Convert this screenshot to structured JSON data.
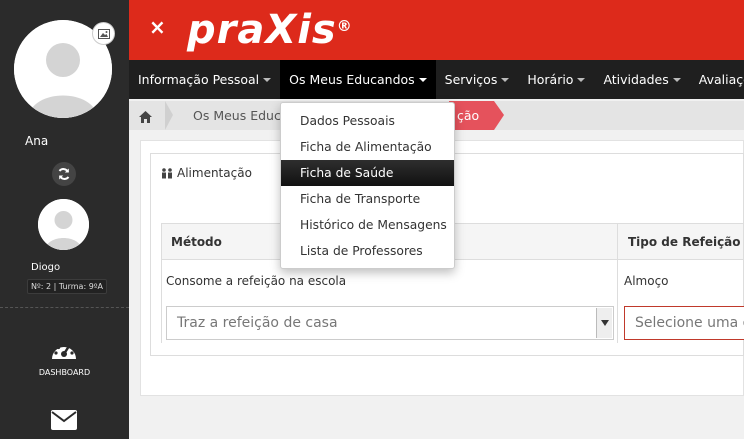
{
  "header": {
    "close_label": "×",
    "logo_text": "praXis",
    "logo_mark": "®",
    "brand_color": "#dd2a1b"
  },
  "sidebar": {
    "user_name": "Ana",
    "child_name": "Diogo",
    "child_info": "Nº: 2 | Turma: 9ºA",
    "dashboard_label": "DASHBOARD",
    "icons": [
      "photo-icon",
      "refresh-icon",
      "dashboard-icon",
      "mail-icon"
    ]
  },
  "nav": {
    "items": [
      {
        "label": "Informação Pessoal"
      },
      {
        "label": "Os Meus Educandos"
      },
      {
        "label": "Serviços"
      },
      {
        "label": "Horário"
      },
      {
        "label": "Atividades"
      },
      {
        "label": "Avaliações"
      }
    ],
    "active_index": 1
  },
  "breadcrumb": {
    "home_icon": "home-icon",
    "item1": "Os Meus Educa",
    "item2": "ção"
  },
  "dropdown": {
    "items": [
      {
        "label": "Dados Pessoais"
      },
      {
        "label": "Ficha de Alimentação"
      },
      {
        "label": "Ficha de Saúde"
      },
      {
        "label": "Ficha de Transporte"
      },
      {
        "label": "Histórico de Mensagens"
      },
      {
        "label": "Lista de Professores"
      }
    ],
    "active_index": 2
  },
  "panel": {
    "title": "Alimentação",
    "title_icon": "people-icon",
    "columns": [
      "Método",
      "Tipo de Refeição"
    ],
    "row": {
      "metodo": "Consome a refeição na escola",
      "tipo": "Almoço"
    },
    "metodo_select_value": "Traz a refeição de casa",
    "tipo_select_placeholder": "Selecione uma op"
  }
}
